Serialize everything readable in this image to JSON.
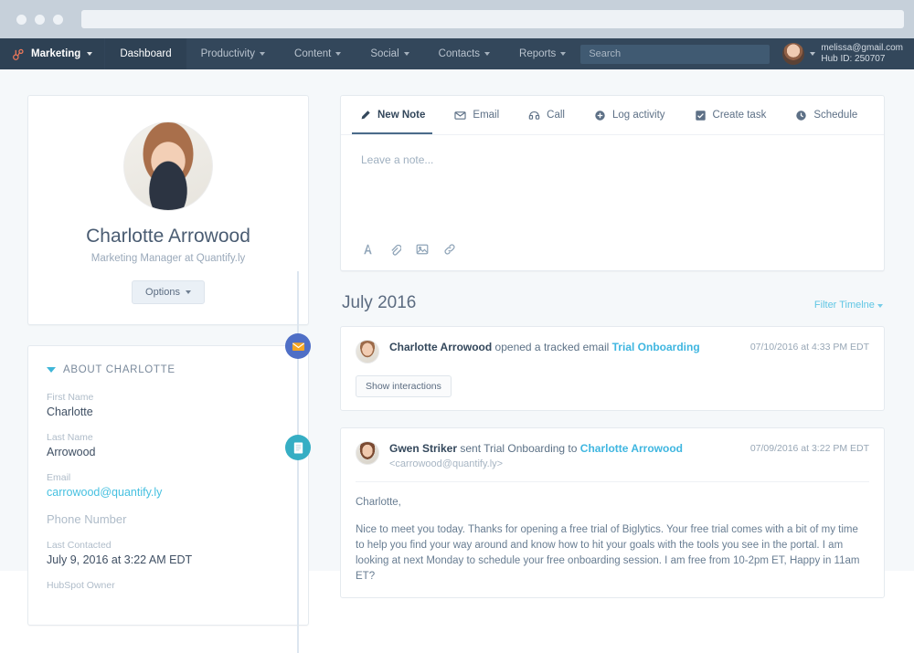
{
  "browser": {
    "dots": 3
  },
  "topnav": {
    "brand": {
      "label": "Marketing",
      "icon": "hubspot-sprocket-icon"
    },
    "items": [
      {
        "label": "Dashboard",
        "active": true,
        "caret": false
      },
      {
        "label": "Productivity",
        "active": false,
        "caret": true
      },
      {
        "label": "Content",
        "active": false,
        "caret": true
      },
      {
        "label": "Social",
        "active": false,
        "caret": true
      },
      {
        "label": "Contacts",
        "active": false,
        "caret": true
      },
      {
        "label": "Reports",
        "active": false,
        "caret": true
      }
    ],
    "search": {
      "placeholder": "Search",
      "value": ""
    },
    "user": {
      "email": "melissa@gmail.com",
      "hub_id": "Hub ID: 250707"
    }
  },
  "profile": {
    "name": "Charlotte Arrowood",
    "subtitle": "Marketing Manager at Quantify.ly",
    "options_label": "Options"
  },
  "about": {
    "heading": "ABOUT CHARLOTTE",
    "fields": [
      {
        "label": "First Name",
        "value": "Charlotte",
        "link": false
      },
      {
        "label": "Last Name",
        "value": "Arrowood",
        "link": false
      },
      {
        "label": "Email",
        "value": "carrowood@quantify.ly",
        "link": true
      },
      {
        "label": "Phone Number",
        "value": "",
        "link": false,
        "big_label": true
      },
      {
        "label": "Last Contacted",
        "value": "July 9, 2016 at 3:22 AM EDT",
        "link": false
      },
      {
        "label": "HubSpot Owner",
        "value": "",
        "link": false
      }
    ]
  },
  "engagement": {
    "tabs": [
      {
        "label": "New Note",
        "icon": "pencil-icon",
        "active": true
      },
      {
        "label": "Email",
        "icon": "envelope-icon",
        "active": false
      },
      {
        "label": "Call",
        "icon": "phone-icon",
        "active": false
      },
      {
        "label": "Log activity",
        "icon": "plus-circle-icon",
        "active": false
      },
      {
        "label": "Create task",
        "icon": "checkbox-icon",
        "active": false
      },
      {
        "label": "Schedule",
        "icon": "clock-icon",
        "active": false
      }
    ],
    "note_placeholder": "Leave a note...",
    "tools": [
      {
        "name": "text-format-icon"
      },
      {
        "name": "paperclip-icon"
      },
      {
        "name": "image-icon"
      },
      {
        "name": "link-icon"
      }
    ]
  },
  "timeline": {
    "month": "July 2016",
    "filter_label": "Filter Timelne",
    "items": [
      {
        "badge": "envelope-icon",
        "badge_color": "#4f6fc6",
        "actor": "Charlotte Arrowood",
        "action": " opened a tracked email ",
        "object": "Trial Onboarding",
        "timestamp": "07/10/2016 at 4:33 PM EDT",
        "button_label": "Show interactions"
      },
      {
        "badge": "document-icon",
        "badge_color": "#36aec4",
        "actor": "Gwen Striker",
        "action": " sent Trial Onboarding to ",
        "object": "Charlotte Arrowood",
        "sub": "<carrowood@quantify.ly>",
        "timestamp": "07/09/2016 at 3:22 PM EDT",
        "email_greeting": "Charlotte,",
        "email_paragraph": "Nice to meet you today.  Thanks for opening a free trial of Biglytics.  Your free trial comes with a bit of my time to help you find your way around and know how to hit your goals with the tools you see in the portal.  I am looking at next Monday to schedule your free onboarding session.  I am free from 10-2pm ET, Happy in 11am ET?"
      }
    ]
  }
}
